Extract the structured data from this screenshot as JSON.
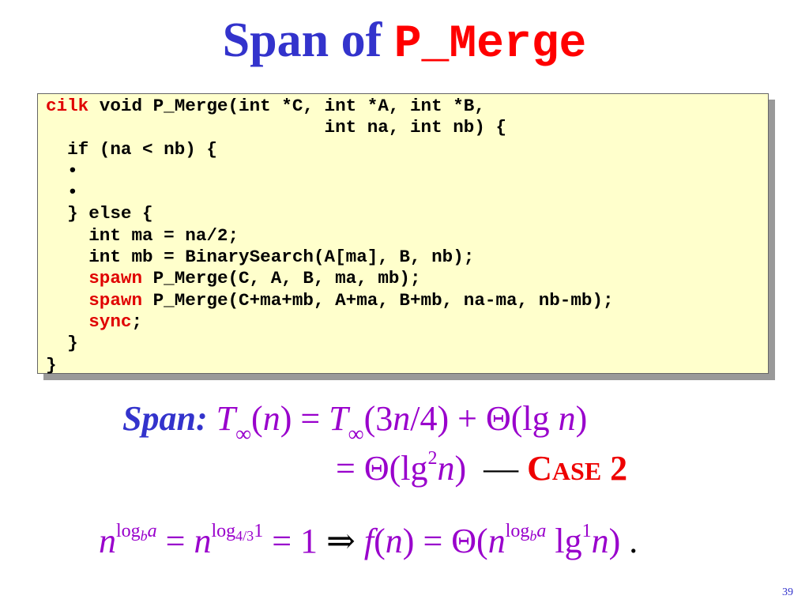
{
  "slide": {
    "title_text": "Span of ",
    "title_code": "P_Merge",
    "page_number": "39"
  },
  "code": {
    "lines": [
      [
        {
          "t": "cilk",
          "kw": true
        },
        {
          "t": " void P_Merge(int *C, int *A, int *B,"
        }
      ],
      [
        {
          "t": "                          int na, int nb) {"
        }
      ],
      [
        {
          "t": "  if (na < nb) {"
        }
      ],
      [
        {
          "t": "  •"
        }
      ],
      [
        {
          "t": "  •"
        }
      ],
      [
        {
          "t": "  } else {"
        }
      ],
      [
        {
          "t": "    int ma = na/2;"
        }
      ],
      [
        {
          "t": "    int mb = BinarySearch(A[ma], B, nb);"
        }
      ],
      [
        {
          "t": "    "
        },
        {
          "t": "spawn",
          "kw": true
        },
        {
          "t": " P_Merge(C, A, B, ma, mb);"
        }
      ],
      [
        {
          "t": "    "
        },
        {
          "t": "spawn",
          "kw": true
        },
        {
          "t": " P_Merge(C+ma+mb, A+ma, B+mb, na-ma, nb-mb);"
        }
      ],
      [
        {
          "t": "    "
        },
        {
          "t": "sync",
          "kw": true
        },
        {
          "t": ";"
        }
      ],
      [
        {
          "t": "  }"
        }
      ],
      [
        {
          "t": "}"
        }
      ]
    ]
  },
  "span": {
    "label": "Span:",
    "T": "T",
    "inf": "∞",
    "lhs_arg": "(n)",
    "eq": "=",
    "rec_arg_open": "(3",
    "rec_n": "n",
    "rec_arg_close": "/4) + Θ(lg ",
    "rec_n2": "n",
    "rec_close": ")",
    "line2_prefix": "= Θ(lg",
    "line2_sup": "2",
    "line2_n": "n",
    "line2_close": ")",
    "dash": "—",
    "case_C": "C",
    "case_rest": "ASE",
    "case_num": "2"
  },
  "master": {
    "n": "n",
    "log": "log",
    "b": "b",
    "a": "a",
    "eq": "=",
    "base2": "4/3",
    "arg2": "1",
    "one": "1",
    "implies": "⇒",
    "f": "f",
    "fn_arg": "(n)",
    "theta_open": "Θ(",
    "lg": "lg",
    "lg_sup": "1",
    "close": ")",
    "period": "."
  }
}
